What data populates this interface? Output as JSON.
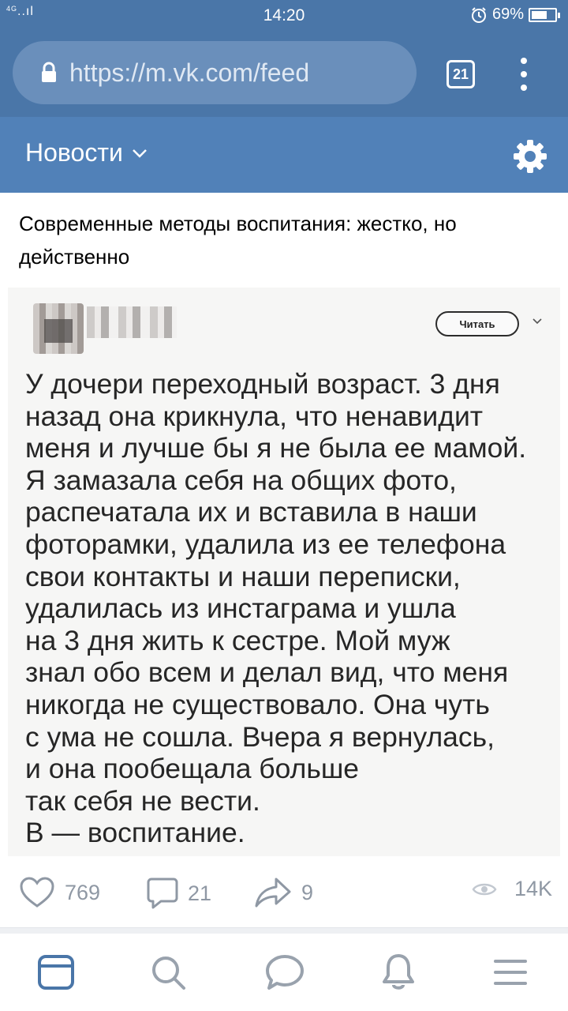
{
  "status_bar": {
    "network": "4G",
    "signal": "..ıl",
    "time": "14:20",
    "battery_percent": "69%",
    "battery_level": 0.69
  },
  "browser": {
    "url": "https://m.vk.com/feed",
    "tab_count": "21"
  },
  "app_header": {
    "title": "Новости"
  },
  "post": {
    "caption": "Современные методы воспитания: жестко, но действенно",
    "image": {
      "read_label": "Читать",
      "text_lines": [
        "У дочери переходный возраст. 3 дня",
        "назад она крикнула, что ненавидит",
        "меня и лучше бы я не была ее мамой.",
        "Я замазала себя на общих фото,",
        "распечатала их и вставила в наши",
        "фоторамки, удалила из ее телефона",
        "свои контакты и наши переписки,",
        "удалилась из инстаграма и ушла",
        "на 3 дня жить к сестре. Мой муж",
        "знал обо всем и делал вид, что меня",
        "никогда не существовало. Она чуть",
        "с ума не сошла. Вчера я вернулась,",
        "и она пообещала больше",
        "так себя не вести.",
        "В — воспитание."
      ]
    },
    "likes": "769",
    "comments": "21",
    "shares": "9",
    "views": "14K"
  },
  "colors": {
    "browser_bar": "#4a76a8",
    "app_header": "#5181b8",
    "accent": "#4a76a8",
    "action_icons": "#8f98a4"
  },
  "icons": [
    "lock-icon",
    "chevron-down-icon",
    "gear-icon",
    "heart-icon",
    "comment-icon",
    "share-icon",
    "eye-icon",
    "news-icon",
    "search-icon",
    "messages-icon",
    "bell-icon",
    "menu-icon"
  ]
}
